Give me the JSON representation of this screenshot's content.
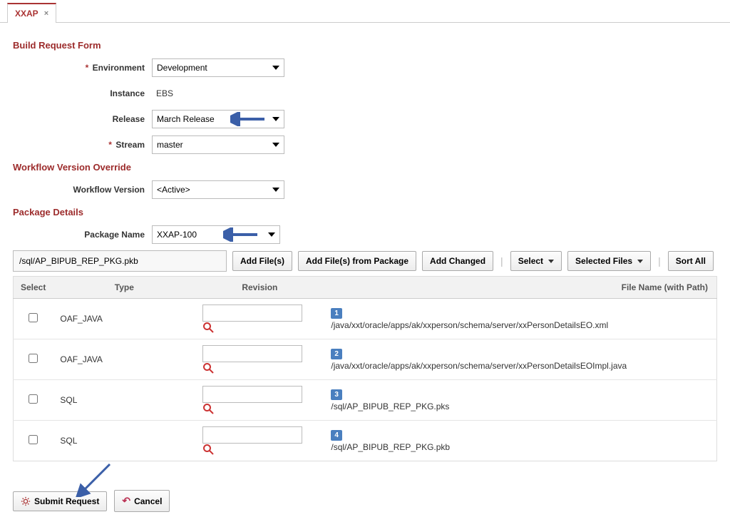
{
  "tab": {
    "label": "XXAP"
  },
  "sections": {
    "buildRequestForm": "Build Request Form",
    "workflowVersionOverride": "Workflow Version Override",
    "packageDetails": "Package Details"
  },
  "form": {
    "environment": {
      "label": "Environment",
      "value": "Development",
      "required": true
    },
    "instance": {
      "label": "Instance",
      "value": "EBS"
    },
    "release": {
      "label": "Release",
      "value": "March Release"
    },
    "stream": {
      "label": "Stream",
      "value": "master",
      "required": true
    },
    "workflowVersion": {
      "label": "Workflow Version",
      "value": "<Active>"
    },
    "packageName": {
      "label": "Package Name",
      "value": "XXAP-100"
    }
  },
  "toolbar": {
    "pathInput": "/sql/AP_BIPUB_REP_PKG.pkb",
    "addFiles": "Add File(s)",
    "addFromPkg": "Add File(s) from Package",
    "addChanged": "Add Changed",
    "select": "Select",
    "selectedFiles": "Selected Files",
    "sortAll": "Sort All"
  },
  "table": {
    "headers": {
      "select": "Select",
      "type": "Type",
      "revision": "Revision",
      "file": "File Name (with Path)"
    },
    "rows": [
      {
        "num": "1",
        "type": "OAF_JAVA",
        "revision": "",
        "file": "/java/xxt/oracle/apps/ak/xxperson/schema/server/xxPersonDetailsEO.xml"
      },
      {
        "num": "2",
        "type": "OAF_JAVA",
        "revision": "",
        "file": "/java/xxt/oracle/apps/ak/xxperson/schema/server/xxPersonDetailsEOImpl.java"
      },
      {
        "num": "3",
        "type": "SQL",
        "revision": "",
        "file": "/sql/AP_BIPUB_REP_PKG.pks"
      },
      {
        "num": "4",
        "type": "SQL",
        "revision": "",
        "file": "/sql/AP_BIPUB_REP_PKG.pkb"
      }
    ]
  },
  "footer": {
    "submit": "Submit Request",
    "cancel": "Cancel"
  }
}
